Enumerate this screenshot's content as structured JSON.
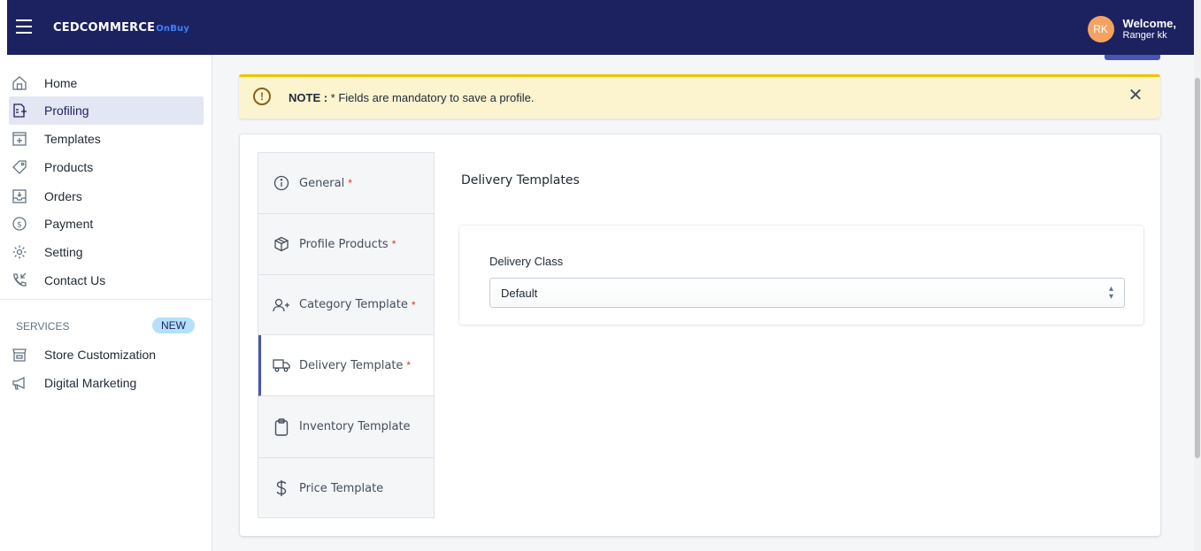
{
  "header": {
    "brand": "CEDCOMMERCE",
    "brand_sub": "OnBuy",
    "avatar_initials": "RK",
    "welcome": "Welcome,",
    "user_name": "Ranger kk"
  },
  "sidebar": {
    "items": [
      {
        "label": "Home",
        "icon": "home-icon"
      },
      {
        "label": "Profiling",
        "icon": "profiling-icon",
        "active": true
      },
      {
        "label": "Templates",
        "icon": "templates-icon"
      },
      {
        "label": "Products",
        "icon": "tag-icon"
      },
      {
        "label": "Orders",
        "icon": "orders-icon"
      },
      {
        "label": "Payment",
        "icon": "dollar-circle-icon"
      },
      {
        "label": "Setting",
        "icon": "gear-icon"
      },
      {
        "label": "Contact Us",
        "icon": "phone-icon"
      }
    ],
    "services_label": "SERVICES",
    "new_badge": "NEW",
    "service_items": [
      {
        "label": "Store Customization",
        "icon": "store-icon"
      },
      {
        "label": "Digital Marketing",
        "icon": "megaphone-icon"
      }
    ]
  },
  "note": {
    "bold": "NOTE :",
    "text": " * Fields are mandatory to save a profile."
  },
  "tabs": [
    {
      "label": "General",
      "required": "*",
      "icon": "info-icon"
    },
    {
      "label": "Profile Products",
      "required": "*",
      "icon": "box-icon"
    },
    {
      "label": "Category Template",
      "required": "*",
      "icon": "add-user-icon"
    },
    {
      "label": "Delivery Template",
      "required": "*",
      "icon": "truck-icon",
      "active": true
    },
    {
      "label": "Inventory Template",
      "required": "",
      "icon": "clipboard-icon"
    },
    {
      "label": "Price Template",
      "required": "",
      "icon": "dollar-icon"
    }
  ],
  "main": {
    "section_title": "Delivery Templates",
    "field_label": "Delivery Class",
    "field_value": "Default"
  },
  "colors": {
    "topbar": "#1c2260",
    "accent": "#4a55b1",
    "note_bg": "#fcf4cf",
    "note_border": "#eec200",
    "avatar": "#f4a261"
  }
}
